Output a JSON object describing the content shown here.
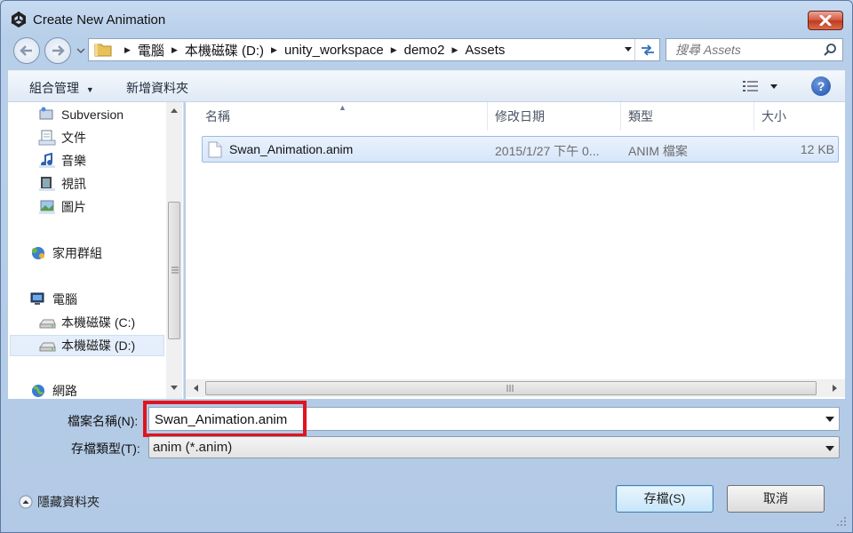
{
  "window": {
    "title": "Create New Animation"
  },
  "address": {
    "crumbs": [
      "電腦",
      "本機磁碟 (D:)",
      "unity_workspace",
      "demo2",
      "Assets"
    ]
  },
  "search": {
    "placeholder": "搜尋 Assets"
  },
  "toolbar": {
    "organize": "組合管理",
    "new_folder": "新增資料夾",
    "help": "?"
  },
  "sidebar": {
    "items": [
      {
        "label": "Subversion",
        "icon": "subversion-icon"
      },
      {
        "label": "文件",
        "icon": "documents-icon"
      },
      {
        "label": "音樂",
        "icon": "music-icon"
      },
      {
        "label": "視訊",
        "icon": "video-icon"
      },
      {
        "label": "圖片",
        "icon": "pictures-icon"
      },
      {
        "label": "家用群組",
        "icon": "homegroup-icon"
      },
      {
        "label": "電腦",
        "icon": "computer-icon"
      },
      {
        "label": "本機磁碟 (C:)",
        "icon": "drive-icon"
      },
      {
        "label": "本機磁碟 (D:)",
        "icon": "drive-icon",
        "selected": true
      },
      {
        "label": "網路",
        "icon": "network-icon"
      }
    ]
  },
  "filelist": {
    "columns": [
      "名稱",
      "修改日期",
      "類型",
      "大小"
    ],
    "rows": [
      {
        "name": "Swan_Animation.anim",
        "modified": "2015/1/27 下午 0...",
        "type": "ANIM 檔案",
        "size": "12 KB"
      }
    ]
  },
  "form": {
    "filename_label": "檔案名稱(N):",
    "filename_value": "Swan_Animation.anim",
    "filetype_label": "存檔類型(T):",
    "filetype_value": "anim (*.anim)"
  },
  "footer": {
    "hide_folders": "隱藏資料夾",
    "save": "存檔(S)",
    "cancel": "取消"
  },
  "colors": {
    "highlight_box": "#e0141e",
    "selection": "#d6e6fa"
  }
}
